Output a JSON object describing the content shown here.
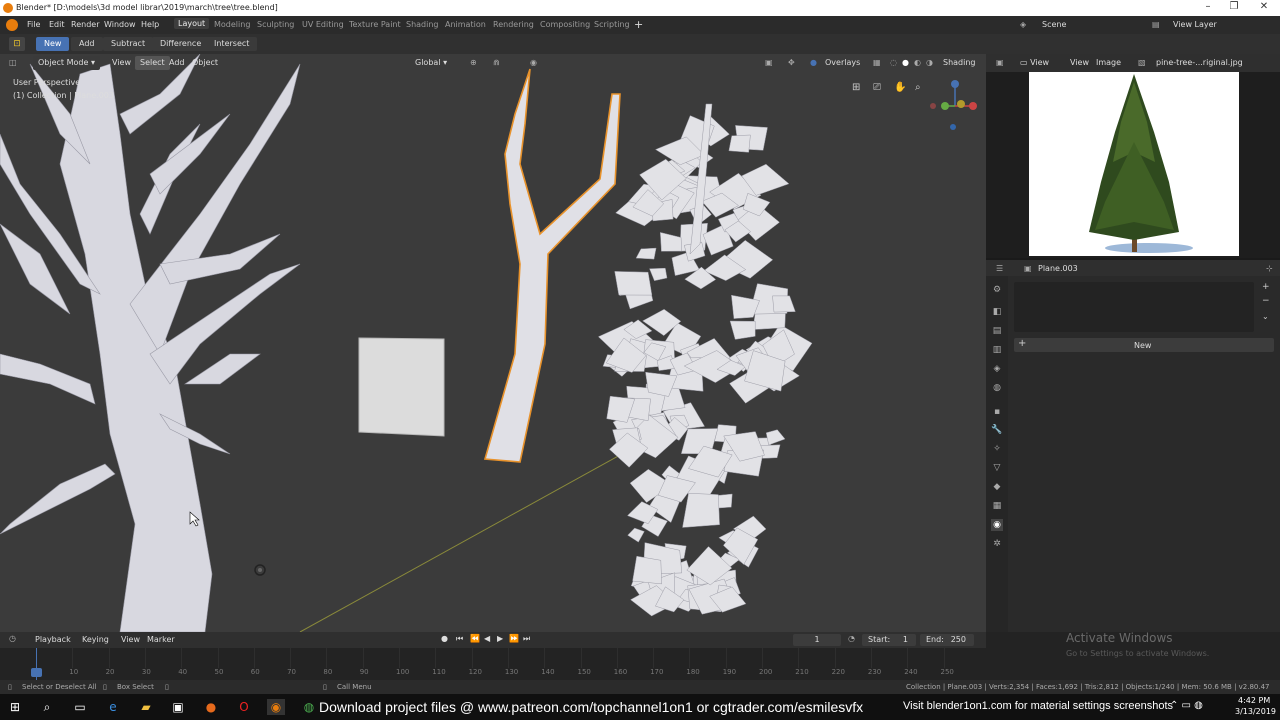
{
  "window": {
    "title": "Blender* [D:\\models\\3d model librar\\2019\\march\\tree\\tree.blend]"
  },
  "menu": {
    "file": "File",
    "edit": "Edit",
    "render": "Render",
    "window": "Window",
    "help": "Help"
  },
  "workspaces": [
    "Layout",
    "Modeling",
    "Sculpting",
    "UV Editing",
    "Texture Paint",
    "Shading",
    "Animation",
    "Rendering",
    "Compositing",
    "Scripting"
  ],
  "scene": {
    "label": "Scene",
    "view_layer": "View Layer"
  },
  "tool_header": {
    "new": "New",
    "add": "Add",
    "subtract": "Subtract",
    "difference": "Difference",
    "intersect": "Intersect"
  },
  "viewport": {
    "mode": "Object Mode",
    "view": "View",
    "select": "Select",
    "add": "Add",
    "object": "Object",
    "orientation": "Global",
    "overlays": "Overlays",
    "shading": "Shading",
    "info_line1": "User Perspective",
    "info_line2": "(1) Collection | Plane.003"
  },
  "image_editor": {
    "view": "View",
    "view2": "View",
    "image": "Image",
    "filename": "pine-tree-...riginal.jpg"
  },
  "properties": {
    "object_name": "Plane.003",
    "new_button": "New"
  },
  "timeline": {
    "playback": "Playback",
    "keying": "Keying",
    "view": "View",
    "marker": "Marker",
    "current_frame": "1",
    "start_label": "Start:",
    "start": "1",
    "end_label": "End:",
    "end": "250",
    "ticks": [
      "0",
      "10",
      "20",
      "30",
      "40",
      "50",
      "60",
      "70",
      "80",
      "90",
      "100",
      "110",
      "120",
      "130",
      "140",
      "150",
      "160",
      "170",
      "180",
      "190",
      "200",
      "210",
      "220",
      "230",
      "240",
      "250"
    ]
  },
  "status": {
    "select": "Select or Deselect All",
    "box": "Box Select",
    "call_menu": "Call Menu",
    "stats": "Collection | Plane.003 | Verts:2,354 | Faces:1,692 | Tris:2,812 | Objects:1/240 | Mem: 50.6 MB | v2.80.47"
  },
  "watermark": {
    "line1": "Activate Windows",
    "line2": "Go to Settings to activate Windows."
  },
  "taskbar": {
    "overlay_text": "Download project files @  www.patreon.com/topchannel1on1  or cgtrader.com/esmilesvfx",
    "overlay_text2": "Visit blender1on1.com for material settings screenshots",
    "time": "4:42 PM",
    "date": "3/13/2019"
  },
  "colors": {
    "accent": "#4772b3",
    "selected_outline": "#e8922b",
    "viewport_bg": "#3b3b3b"
  }
}
